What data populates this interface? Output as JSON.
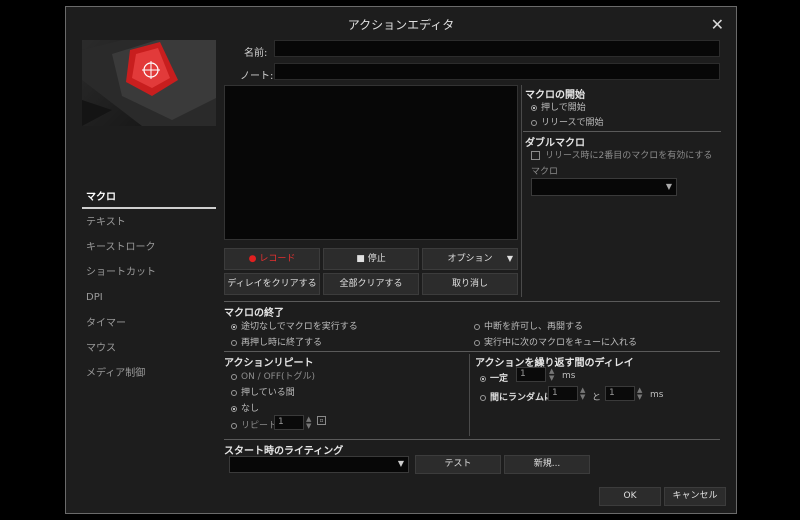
{
  "window": {
    "title": "アクションエディタ"
  },
  "sidebar": {
    "items": [
      {
        "label": "マクロ",
        "active": true
      },
      {
        "label": "テキスト"
      },
      {
        "label": "キーストローク"
      },
      {
        "label": "ショートカット"
      },
      {
        "label": "DPI"
      },
      {
        "label": "タイマー"
      },
      {
        "label": "マウス"
      },
      {
        "label": "メディア制御"
      }
    ]
  },
  "form": {
    "name_label": "名前:",
    "name_value": "",
    "note_label": "ノート:",
    "note_value": ""
  },
  "record": {
    "record_label": "レコード",
    "stop_label": "停止",
    "options_label": "オプション",
    "clear_delay_label": "ディレイをクリアする",
    "clear_all_label": "全部クリアする",
    "undo_label": "取り消し"
  },
  "macro_start": {
    "title": "マクロの開始",
    "options": [
      "押しで開始",
      "リリースで開始"
    ]
  },
  "double_macro": {
    "title": "ダブルマクロ",
    "checkbox_label": "リリース時に2番目のマクロを有効にする",
    "macro_label": "マクロ",
    "macro_value": ""
  },
  "macro_end": {
    "title": "マクロの終了",
    "options": [
      "途切なしでマクロを実行する",
      "中断を許可し、再開する",
      "再押し時に終了する",
      "実行中に次のマクロをキューに入れる"
    ]
  },
  "action_repeat": {
    "title": "アクションリピート",
    "options": [
      "ON / OFF(トグル)",
      "押している間",
      "なし",
      "リピート"
    ],
    "repeat_value": "1"
  },
  "repeat_delay": {
    "title": "アクションを繰り返す間のディレイ",
    "fixed_label": "一定",
    "fixed_value": "1",
    "random_label": "間にランダムに",
    "random_min": "1",
    "and_label": "と",
    "random_max": "1",
    "unit": "ms"
  },
  "lighting": {
    "title": "スタート時のライティング",
    "value": "",
    "test_label": "テスト",
    "new_label": "新規..."
  },
  "footer": {
    "ok_label": "OK",
    "cancel_label": "キャンセル"
  },
  "colors": {
    "record_red": "#e02020",
    "accent": "#c81e1e"
  }
}
